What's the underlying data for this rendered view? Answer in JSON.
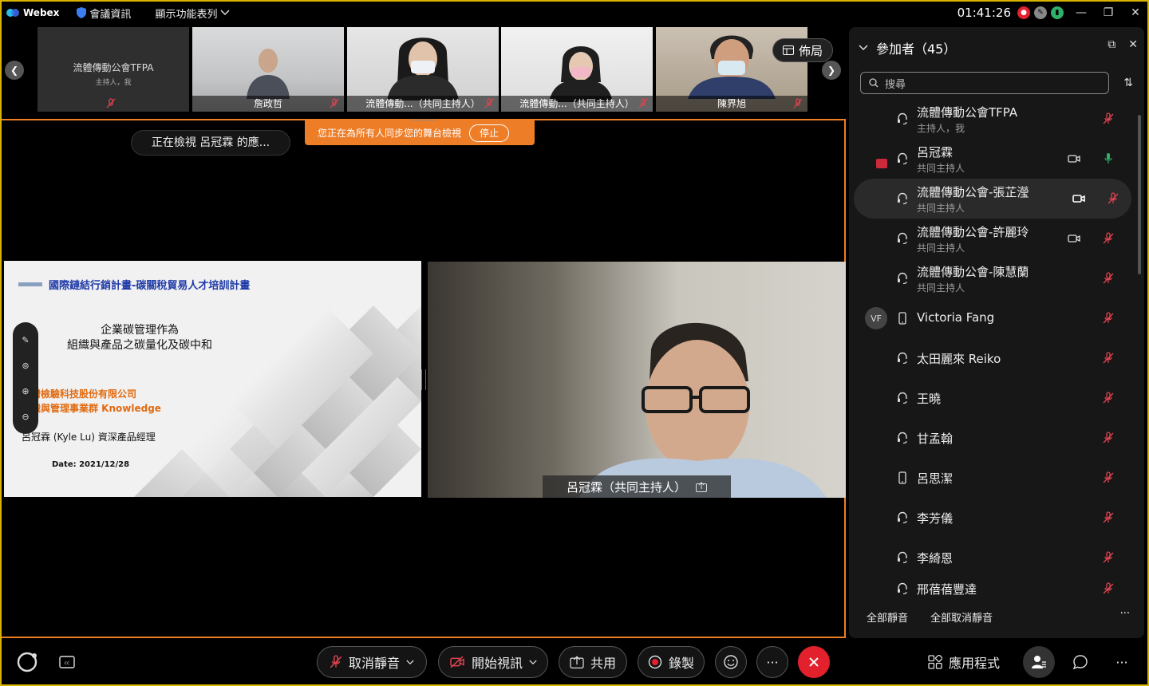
{
  "titlebar": {
    "app_name": "Webex",
    "meeting_info": "會議資訊",
    "show_menu": "顯示功能表列",
    "clock": "01:41:26"
  },
  "strip": {
    "layout_label": "佈局",
    "thumbs": [
      {
        "name": "流體傳動公會TFPA",
        "role": "主持人，我"
      },
      {
        "name": "詹政哲"
      },
      {
        "name": "流體傳動...（共同主持人）"
      },
      {
        "name": "流體傳動...（共同主持人）"
      },
      {
        "name": "陳界旭"
      }
    ]
  },
  "stage": {
    "viewing_pill": "正在檢視 呂冠霖 的應...",
    "sync_banner": "您正在為所有人同步您的舞台檢視",
    "sync_stop": "停止",
    "speaker_label": "呂冠霖（共同主持人）"
  },
  "slide": {
    "title": "國際鏈結行銷計畫-碳關稅貿易人才培訓計畫",
    "heading_line1": "企業碳管理作為",
    "heading_line2": "組織與產品之碳量化及碳中和",
    "company_line1": "台灣檢驗科技股份有限公司",
    "company_line2": "知識與管理事業群 Knowledge",
    "person": "呂冠霖 (Kyle Lu) 資深產品經理",
    "date": "Date: 2021/12/28"
  },
  "panel": {
    "title": "參加者（45）",
    "search_placeholder": "搜尋",
    "participants": [
      {
        "name": "流體傳動公會TFPA",
        "role": "主持人，我",
        "avatar": "",
        "mic": "muted"
      },
      {
        "name": "呂冠霖",
        "role": "共同主持人",
        "avatar": "",
        "mic": "active"
      },
      {
        "name": "流體傳動公會-張芷瀅",
        "role": "共同主持人",
        "avatar": "",
        "mic": "muted"
      },
      {
        "name": "流體傳動公會-許麗玲",
        "role": "共同主持人",
        "avatar": "",
        "mic": "muted"
      },
      {
        "name": "流體傳動公會-陳慧蘭",
        "role": "共同主持人",
        "avatar": "",
        "mic": "muted"
      },
      {
        "name": "Victoria Fang",
        "role": "",
        "avatar": "VF",
        "mic": "muted"
      },
      {
        "name": "太田麗來 Reiko",
        "role": "",
        "avatar": "",
        "mic": "muted"
      },
      {
        "name": "王曉",
        "role": "",
        "avatar": "",
        "mic": "muted"
      },
      {
        "name": "甘孟翰",
        "role": "",
        "avatar": "",
        "mic": "muted"
      },
      {
        "name": "呂思潔",
        "role": "",
        "avatar": "",
        "mic": "muted"
      },
      {
        "name": "李芳儀",
        "role": "",
        "avatar": "",
        "mic": "muted"
      },
      {
        "name": "李綺恩",
        "role": "",
        "avatar": "",
        "mic": "muted"
      },
      {
        "name": "邢蓓蓓豐達",
        "role": "",
        "avatar": "",
        "mic": "muted"
      }
    ],
    "mute_all": "全部靜音",
    "unmute_all": "全部取消靜音",
    "more": "···"
  },
  "toolbar": {
    "unmute": "取消靜音",
    "start_video": "開始視訊",
    "share": "共用",
    "record": "錄製",
    "more": "···",
    "apps": "應用程式",
    "more_right": "···"
  },
  "colors": {
    "accent_orange": "#ee7d28",
    "end_red": "#e2212d",
    "muted_red": "#e0434f",
    "active_green": "#2fb16a",
    "frame_yellow": "#d8b400"
  }
}
